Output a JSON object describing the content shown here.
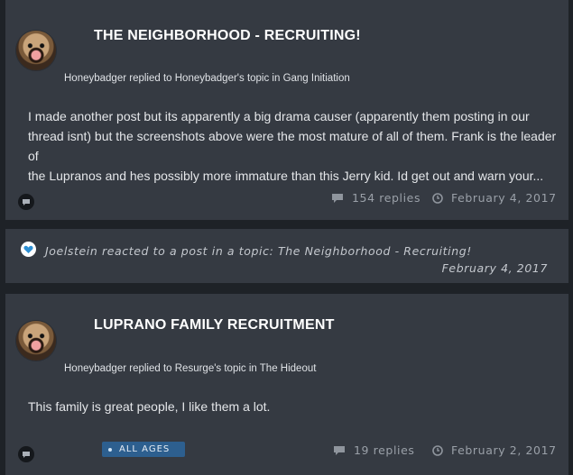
{
  "posts": [
    {
      "title": "THE NEIGHBORHOOD - RECRUITING!",
      "meta": "Honeybadger replied to Honeybadger's topic in Gang Initiation",
      "body_line1": "I made another post but its apparently a big drama causer (apparently them posting in our",
      "body_line2": "thread isnt) but the screenshots above were the most mature of all of them. Frank is the leader of",
      "body_line3": "the Lupranos and hes possibly more immature than this Jerry kid. Id get out and warn your...",
      "replies": "154 replies",
      "date": "February 4, 2017"
    },
    {
      "title": "LUPRANO FAMILY RECRUITMENT",
      "meta": "Honeybadger replied to Resurge's topic in The Hideout",
      "body_line1": "This family is great people, I like them a lot.",
      "tag": "ALL AGES",
      "replies": "19 replies",
      "date": "February 2, 2017"
    }
  ],
  "reaction": {
    "text": "Joelstein reacted to a post in a topic: The Neighborhood - Recruiting!",
    "date": "February 4, 2017",
    "icon": "heart-icon"
  },
  "icons": {
    "comment": "comment-icon",
    "clock": "clock-icon",
    "avatar": "avatar"
  }
}
